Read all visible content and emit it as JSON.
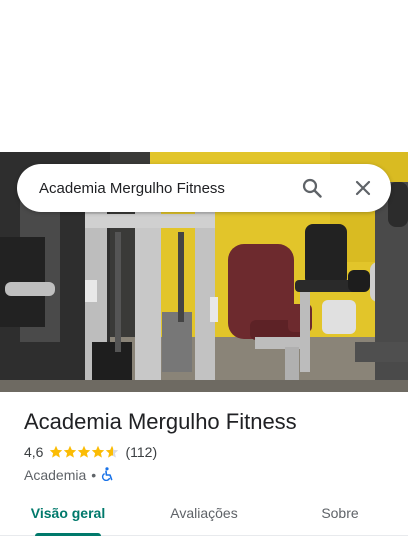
{
  "search": {
    "query": "Academia Mergulho Fitness",
    "search_icon": "search-icon",
    "clear_icon": "close-icon"
  },
  "place": {
    "name": "Academia Mergulho Fitness",
    "rating": "4,6",
    "rating_value": 4.6,
    "review_count": "(112)",
    "category": "Academia",
    "separator": "•",
    "accessibility_icon": "wheelchair-icon"
  },
  "tabs": [
    {
      "label": "Visão geral",
      "active": true
    },
    {
      "label": "Avaliações",
      "active": false
    },
    {
      "label": "Sobre",
      "active": false
    }
  ],
  "colors": {
    "accent": "#00796b",
    "star": "#fbbc04",
    "accessibility": "#1a73e8"
  }
}
